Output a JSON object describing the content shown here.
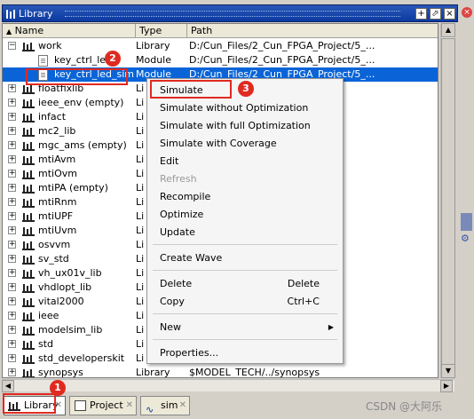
{
  "window": {
    "title": "Library"
  },
  "columns": [
    "Name",
    "Type",
    "Path"
  ],
  "rows": [
    {
      "name": "work",
      "type": "Library",
      "path": "D:/Cun_Files/2_Cun_FPGA_Project/5_..."
    },
    {
      "name": "key_ctrl_led",
      "type": "Module",
      "path": "D:/Cun_Files/2_Cun_FPGA_Project/5_..."
    },
    {
      "name": "key_ctrl_led_sim",
      "type": "Module",
      "path": "D:/Cun_Files/2_Cun_FPGA_Project/5_..."
    },
    {
      "name": "floatfixlib",
      "type": "Li"
    },
    {
      "name": "ieee_env  (empty)",
      "type": "Li"
    },
    {
      "name": "infact",
      "type": "Li"
    },
    {
      "name": "mc2_lib",
      "type": "Li"
    },
    {
      "name": "mgc_ams  (empty)",
      "type": "Li"
    },
    {
      "name": "mtiAvm",
      "type": "Li"
    },
    {
      "name": "mtiOvm",
      "type": "Li"
    },
    {
      "name": "mtiPA  (empty)",
      "type": "Li"
    },
    {
      "name": "mtiRnm",
      "type": "Li"
    },
    {
      "name": "mtiUPF",
      "type": "Li"
    },
    {
      "name": "mtiUvm",
      "type": "Li"
    },
    {
      "name": "osvvm",
      "type": "Li"
    },
    {
      "name": "sv_std",
      "type": "Li"
    },
    {
      "name": "vh_ux01v_lib",
      "type": "Li"
    },
    {
      "name": "vhdlopt_lib",
      "type": "Li"
    },
    {
      "name": "vital2000",
      "type": "Li"
    },
    {
      "name": "ieee",
      "type": "Li"
    },
    {
      "name": "modelsim_lib",
      "type": "Li"
    },
    {
      "name": "std",
      "type": "Li"
    },
    {
      "name": "std_developerskit",
      "type": "Li"
    },
    {
      "name": "synopsys",
      "type": "Library",
      "path": "$MODEL_TECH/../synopsys"
    }
  ],
  "menu": {
    "simulate": "Simulate",
    "sim_no_opt": "Simulate without Optimization",
    "sim_full_opt": "Simulate with full Optimization",
    "sim_coverage": "Simulate with Coverage",
    "edit": "Edit",
    "refresh": "Refresh",
    "recompile": "Recompile",
    "optimize": "Optimize",
    "update": "Update",
    "create_wave": "Create Wave",
    "delete": "Delete",
    "delete_sc": "Delete",
    "copy": "Copy",
    "copy_sc": "Ctrl+C",
    "new": "New",
    "properties": "Properties..."
  },
  "tabs": [
    "Library",
    "Project",
    "sim"
  ],
  "badges": [
    "1",
    "2",
    "3"
  ],
  "watermark": "CSDN @大阿乐"
}
